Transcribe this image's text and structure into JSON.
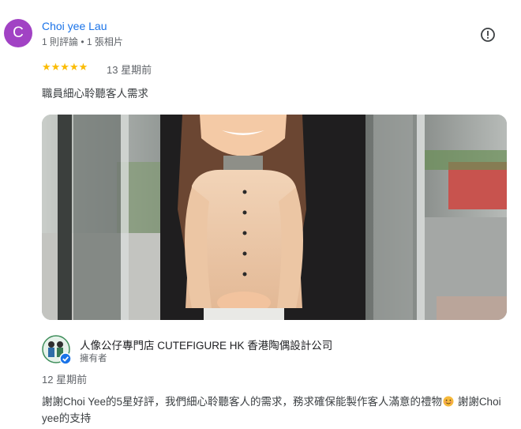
{
  "reviewer": {
    "initial": "C",
    "name": "Choi yee Lau",
    "meta": "1 則評論 • 1 張相片",
    "avatar_color": "#a142c4"
  },
  "review": {
    "stars": "★★★★★",
    "rating": 5,
    "date": "13 星期前",
    "text": "職員細心聆聽客人需求"
  },
  "photo": {
    "icon": "bobblehead-figure-photo"
  },
  "owner_reply": {
    "name": "人像公仔專門店 CUTEFIGURE HK 香港陶偶設計公司",
    "role": "擁有者",
    "date": "12 星期前",
    "text_before_emoji": "謝謝Choi Yee的5星好評，我們細心聆聽客人的需求，務求確保能製作客人滿意的禮物",
    "emoji": "smiling-face-emoji",
    "text_after_emoji": " 謝謝Choi yee的支持"
  },
  "colors": {
    "link_blue": "#1a73e8",
    "star_yellow": "#fbbc04",
    "meta_gray": "#5f6368"
  }
}
